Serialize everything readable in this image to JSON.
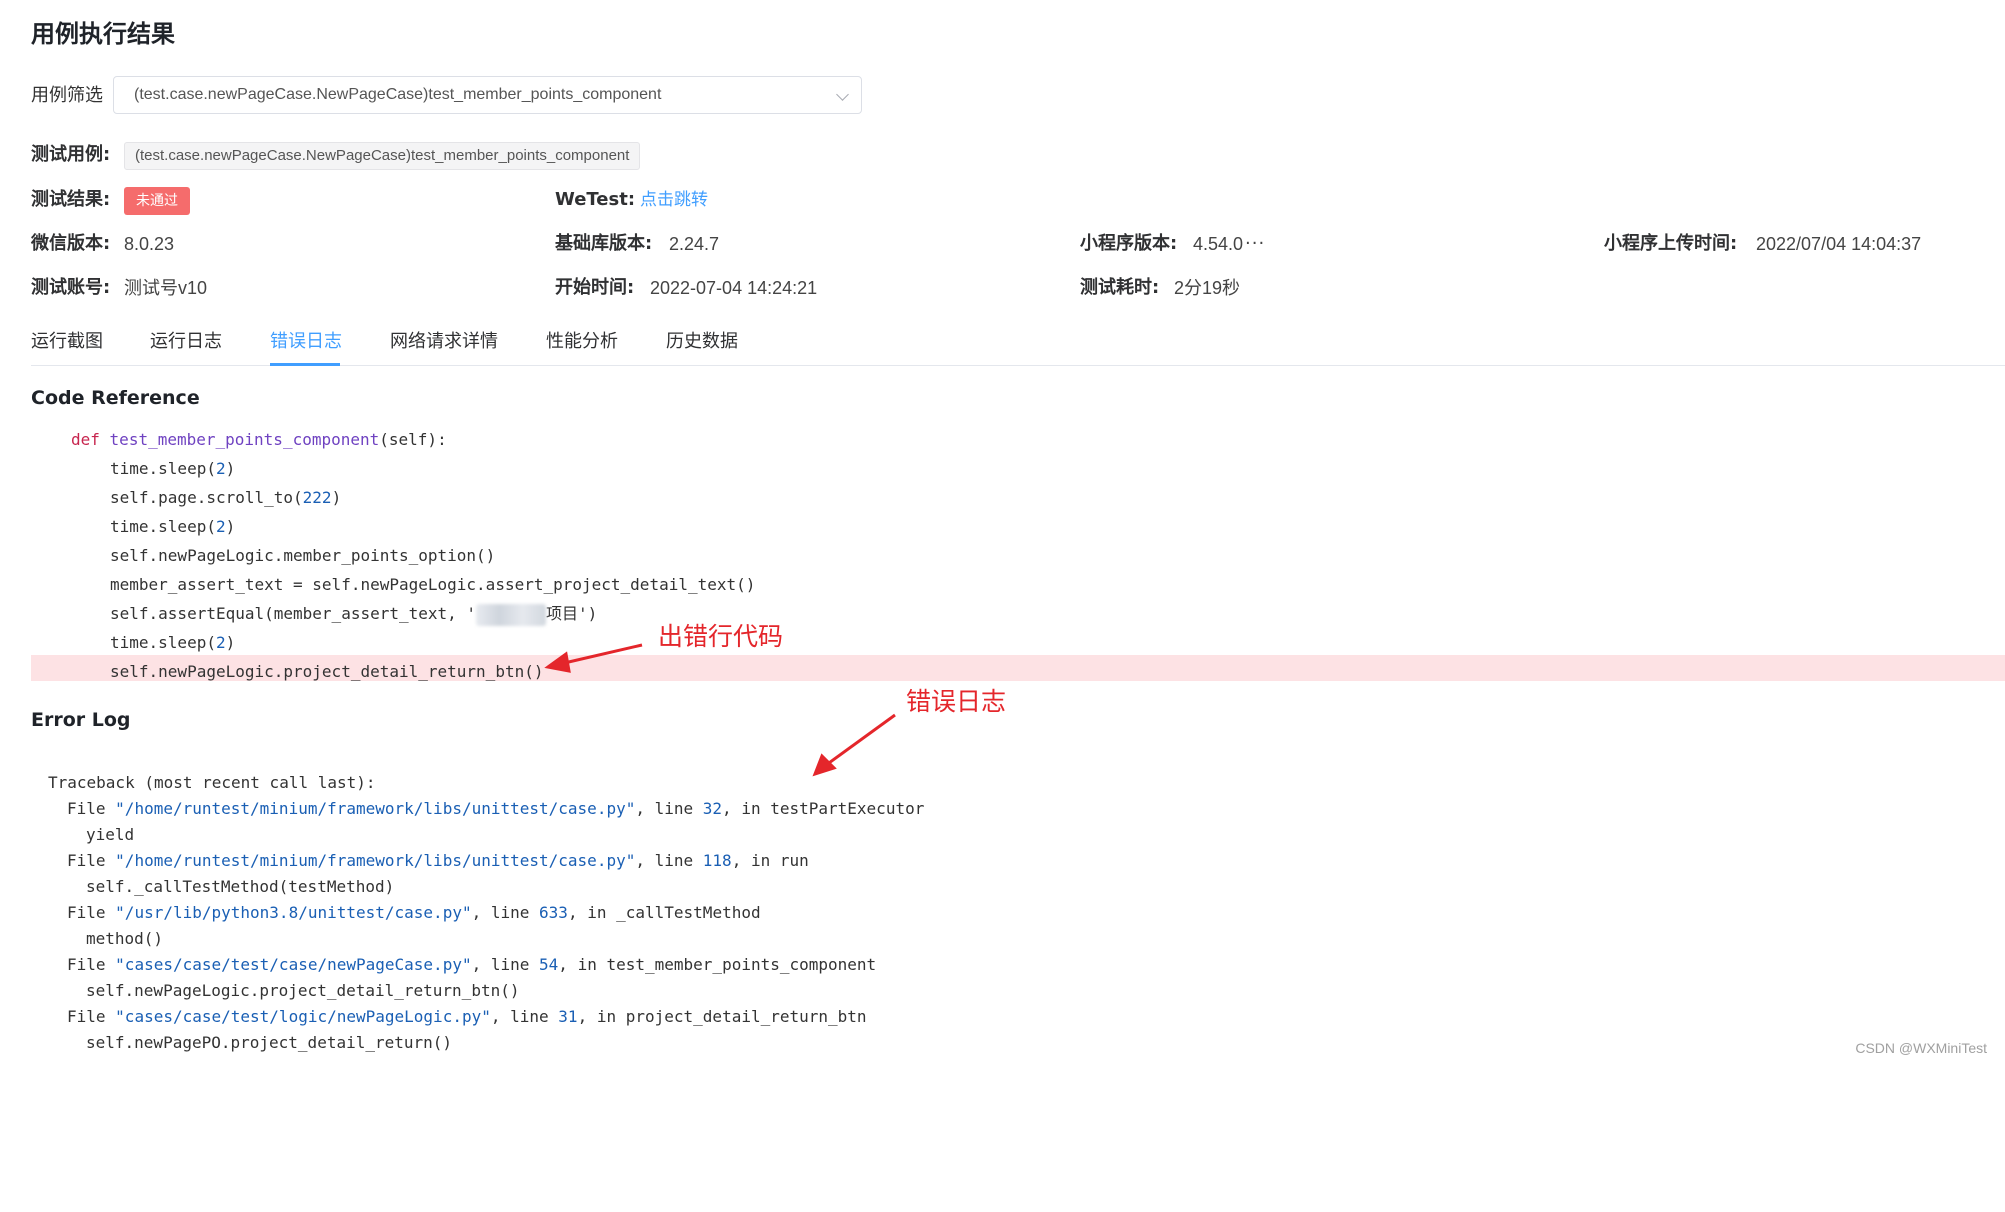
{
  "page_title": "用例执行结果",
  "filter": {
    "label": "用例筛选",
    "selected": "(test.case.newPageCase.NewPageCase)test_member_points_component"
  },
  "info": {
    "case_label": "测试用例:",
    "case_value": "(test.case.newPageCase.NewPageCase)test_member_points_component",
    "result_label": "测试结果:",
    "result_badge": "未通过",
    "wetest_label": "WeTest:",
    "wetest_link": "点击跳转",
    "wechat_version_label": "微信版本:",
    "wechat_version": "8.0.23",
    "base_lib_label": "基础库版本:",
    "base_lib": "2.24.7",
    "mini_version_label": "小程序版本:",
    "mini_version": "4.54.0",
    "mini_version_more": "···",
    "upload_time_label": "小程序上传时间:",
    "upload_time": "2022/07/04 14:04:37",
    "account_label": "测试账号:",
    "account": "测试号v10",
    "start_time_label": "开始时间:",
    "start_time": "2022-07-04 14:24:21",
    "duration_label": "测试耗时:",
    "duration": "2分19秒"
  },
  "tabs": [
    {
      "label": "运行截图"
    },
    {
      "label": "运行日志"
    },
    {
      "label": "错误日志",
      "active": true
    },
    {
      "label": "网络请求详情"
    },
    {
      "label": "性能分析"
    },
    {
      "label": "历史数据"
    }
  ],
  "code_reference": {
    "title": "Code Reference",
    "def_kw": "def",
    "func_name": "test_member_points_component",
    "func_args": "(self):",
    "lines": [
      {
        "a": "time.sleep(",
        "n": "2",
        "b": ")"
      },
      {
        "a": "self.page.scroll_to(",
        "n": "222",
        "b": ")"
      },
      {
        "a": "time.sleep(",
        "n": "2",
        "b": ")"
      },
      {
        "a": "self.newPageLogic.member_points_option()"
      },
      {
        "a": "member_assert_text = self.newPageLogic.assert_project_detail_text()"
      },
      {
        "a": "self.assertEqual(member_assert_text, '",
        "tail": "项目')"
      },
      {
        "a": "time.sleep(",
        "n": "2",
        "b": ")"
      },
      {
        "a": "self.newPageLogic.project_detail_return_btn()"
      }
    ]
  },
  "error_log": {
    "title": "Error Log",
    "traceback_head": "Traceback (most recent call last):",
    "frames": [
      {
        "file": "\"/home/runtest/minium/framework/libs/unittest/case.py\"",
        "line": "32",
        "func": "testPartExecutor",
        "code": "yield"
      },
      {
        "file": "\"/home/runtest/minium/framework/libs/unittest/case.py\"",
        "line": "118",
        "func": "run",
        "code": "self._callTestMethod(testMethod)"
      },
      {
        "file": "\"/usr/lib/python3.8/unittest/case.py\"",
        "line": "633",
        "func": "_callTestMethod",
        "code": "method()"
      },
      {
        "file": "\"cases/case/test/case/newPageCase.py\"",
        "line": "54",
        "func": "test_member_points_component",
        "code": "self.newPageLogic.project_detail_return_btn()"
      },
      {
        "file": "\"cases/case/test/logic/newPageLogic.py\"",
        "line": "31",
        "func": "project_detail_return_btn",
        "code": "self.newPagePO.project_detail_return()"
      }
    ]
  },
  "annotations": {
    "error_line": "出错行代码",
    "error_log": "错误日志",
    "color": "#e4262b"
  },
  "watermark": "CSDN @WXMiniTest",
  "colors": {
    "accent": "#409eff",
    "fail": "#f56c6c",
    "error_row": "#fde2e4"
  }
}
